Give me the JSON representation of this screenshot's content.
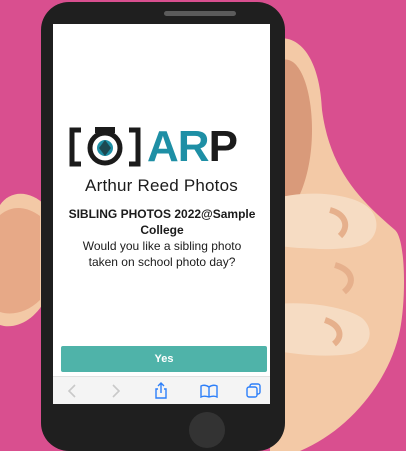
{
  "logo": {
    "text": "ARP",
    "letter_colors": [
      "#1e8fa5",
      "#1e8fa5",
      "#1b1b1b"
    ]
  },
  "brand": {
    "name": "Arthur Reed Photos"
  },
  "content": {
    "headline": "SIBLING PHOTOS 2022@Sample College",
    "question": "Would you like a sibling photo taken on school photo day?"
  },
  "actions": {
    "yes_label": "Yes"
  },
  "toolbar": {
    "icons": [
      "back-icon",
      "forward-icon",
      "share-icon",
      "bookmarks-icon",
      "tabs-icon"
    ]
  },
  "colors": {
    "background": "#d94f8f",
    "accent": "#4fb3a9",
    "brand_blue": "#1e8fa5",
    "toolbar_icon": "#2d7ff9"
  }
}
